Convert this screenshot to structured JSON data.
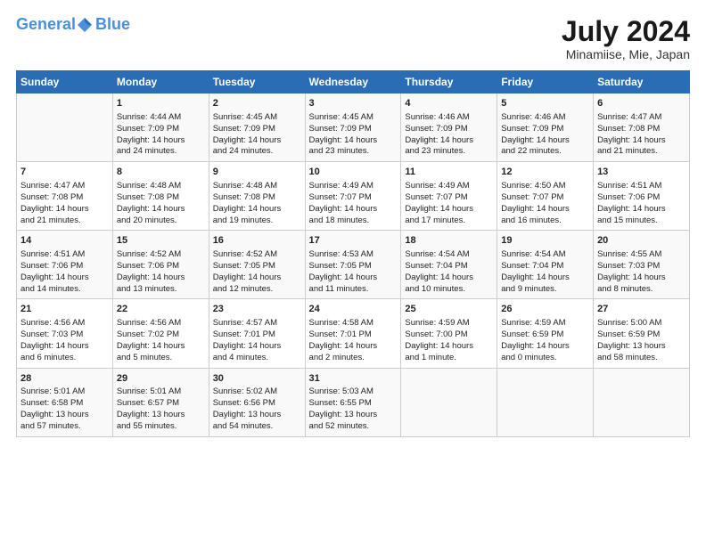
{
  "header": {
    "logo_line1": "General",
    "logo_line2": "Blue",
    "title": "July 2024",
    "subtitle": "Minamiise, Mie, Japan"
  },
  "columns": [
    "Sunday",
    "Monday",
    "Tuesday",
    "Wednesday",
    "Thursday",
    "Friday",
    "Saturday"
  ],
  "rows": [
    [
      {
        "day": "",
        "info": ""
      },
      {
        "day": "1",
        "info": "Sunrise: 4:44 AM\nSunset: 7:09 PM\nDaylight: 14 hours\nand 24 minutes."
      },
      {
        "day": "2",
        "info": "Sunrise: 4:45 AM\nSunset: 7:09 PM\nDaylight: 14 hours\nand 24 minutes."
      },
      {
        "day": "3",
        "info": "Sunrise: 4:45 AM\nSunset: 7:09 PM\nDaylight: 14 hours\nand 23 minutes."
      },
      {
        "day": "4",
        "info": "Sunrise: 4:46 AM\nSunset: 7:09 PM\nDaylight: 14 hours\nand 23 minutes."
      },
      {
        "day": "5",
        "info": "Sunrise: 4:46 AM\nSunset: 7:09 PM\nDaylight: 14 hours\nand 22 minutes."
      },
      {
        "day": "6",
        "info": "Sunrise: 4:47 AM\nSunset: 7:08 PM\nDaylight: 14 hours\nand 21 minutes."
      }
    ],
    [
      {
        "day": "7",
        "info": "Sunrise: 4:47 AM\nSunset: 7:08 PM\nDaylight: 14 hours\nand 21 minutes."
      },
      {
        "day": "8",
        "info": "Sunrise: 4:48 AM\nSunset: 7:08 PM\nDaylight: 14 hours\nand 20 minutes."
      },
      {
        "day": "9",
        "info": "Sunrise: 4:48 AM\nSunset: 7:08 PM\nDaylight: 14 hours\nand 19 minutes."
      },
      {
        "day": "10",
        "info": "Sunrise: 4:49 AM\nSunset: 7:07 PM\nDaylight: 14 hours\nand 18 minutes."
      },
      {
        "day": "11",
        "info": "Sunrise: 4:49 AM\nSunset: 7:07 PM\nDaylight: 14 hours\nand 17 minutes."
      },
      {
        "day": "12",
        "info": "Sunrise: 4:50 AM\nSunset: 7:07 PM\nDaylight: 14 hours\nand 16 minutes."
      },
      {
        "day": "13",
        "info": "Sunrise: 4:51 AM\nSunset: 7:06 PM\nDaylight: 14 hours\nand 15 minutes."
      }
    ],
    [
      {
        "day": "14",
        "info": "Sunrise: 4:51 AM\nSunset: 7:06 PM\nDaylight: 14 hours\nand 14 minutes."
      },
      {
        "day": "15",
        "info": "Sunrise: 4:52 AM\nSunset: 7:06 PM\nDaylight: 14 hours\nand 13 minutes."
      },
      {
        "day": "16",
        "info": "Sunrise: 4:52 AM\nSunset: 7:05 PM\nDaylight: 14 hours\nand 12 minutes."
      },
      {
        "day": "17",
        "info": "Sunrise: 4:53 AM\nSunset: 7:05 PM\nDaylight: 14 hours\nand 11 minutes."
      },
      {
        "day": "18",
        "info": "Sunrise: 4:54 AM\nSunset: 7:04 PM\nDaylight: 14 hours\nand 10 minutes."
      },
      {
        "day": "19",
        "info": "Sunrise: 4:54 AM\nSunset: 7:04 PM\nDaylight: 14 hours\nand 9 minutes."
      },
      {
        "day": "20",
        "info": "Sunrise: 4:55 AM\nSunset: 7:03 PM\nDaylight: 14 hours\nand 8 minutes."
      }
    ],
    [
      {
        "day": "21",
        "info": "Sunrise: 4:56 AM\nSunset: 7:03 PM\nDaylight: 14 hours\nand 6 minutes."
      },
      {
        "day": "22",
        "info": "Sunrise: 4:56 AM\nSunset: 7:02 PM\nDaylight: 14 hours\nand 5 minutes."
      },
      {
        "day": "23",
        "info": "Sunrise: 4:57 AM\nSunset: 7:01 PM\nDaylight: 14 hours\nand 4 minutes."
      },
      {
        "day": "24",
        "info": "Sunrise: 4:58 AM\nSunset: 7:01 PM\nDaylight: 14 hours\nand 2 minutes."
      },
      {
        "day": "25",
        "info": "Sunrise: 4:59 AM\nSunset: 7:00 PM\nDaylight: 14 hours\nand 1 minute."
      },
      {
        "day": "26",
        "info": "Sunrise: 4:59 AM\nSunset: 6:59 PM\nDaylight: 14 hours\nand 0 minutes."
      },
      {
        "day": "27",
        "info": "Sunrise: 5:00 AM\nSunset: 6:59 PM\nDaylight: 13 hours\nand 58 minutes."
      }
    ],
    [
      {
        "day": "28",
        "info": "Sunrise: 5:01 AM\nSunset: 6:58 PM\nDaylight: 13 hours\nand 57 minutes."
      },
      {
        "day": "29",
        "info": "Sunrise: 5:01 AM\nSunset: 6:57 PM\nDaylight: 13 hours\nand 55 minutes."
      },
      {
        "day": "30",
        "info": "Sunrise: 5:02 AM\nSunset: 6:56 PM\nDaylight: 13 hours\nand 54 minutes."
      },
      {
        "day": "31",
        "info": "Sunrise: 5:03 AM\nSunset: 6:55 PM\nDaylight: 13 hours\nand 52 minutes."
      },
      {
        "day": "",
        "info": ""
      },
      {
        "day": "",
        "info": ""
      },
      {
        "day": "",
        "info": ""
      }
    ]
  ]
}
